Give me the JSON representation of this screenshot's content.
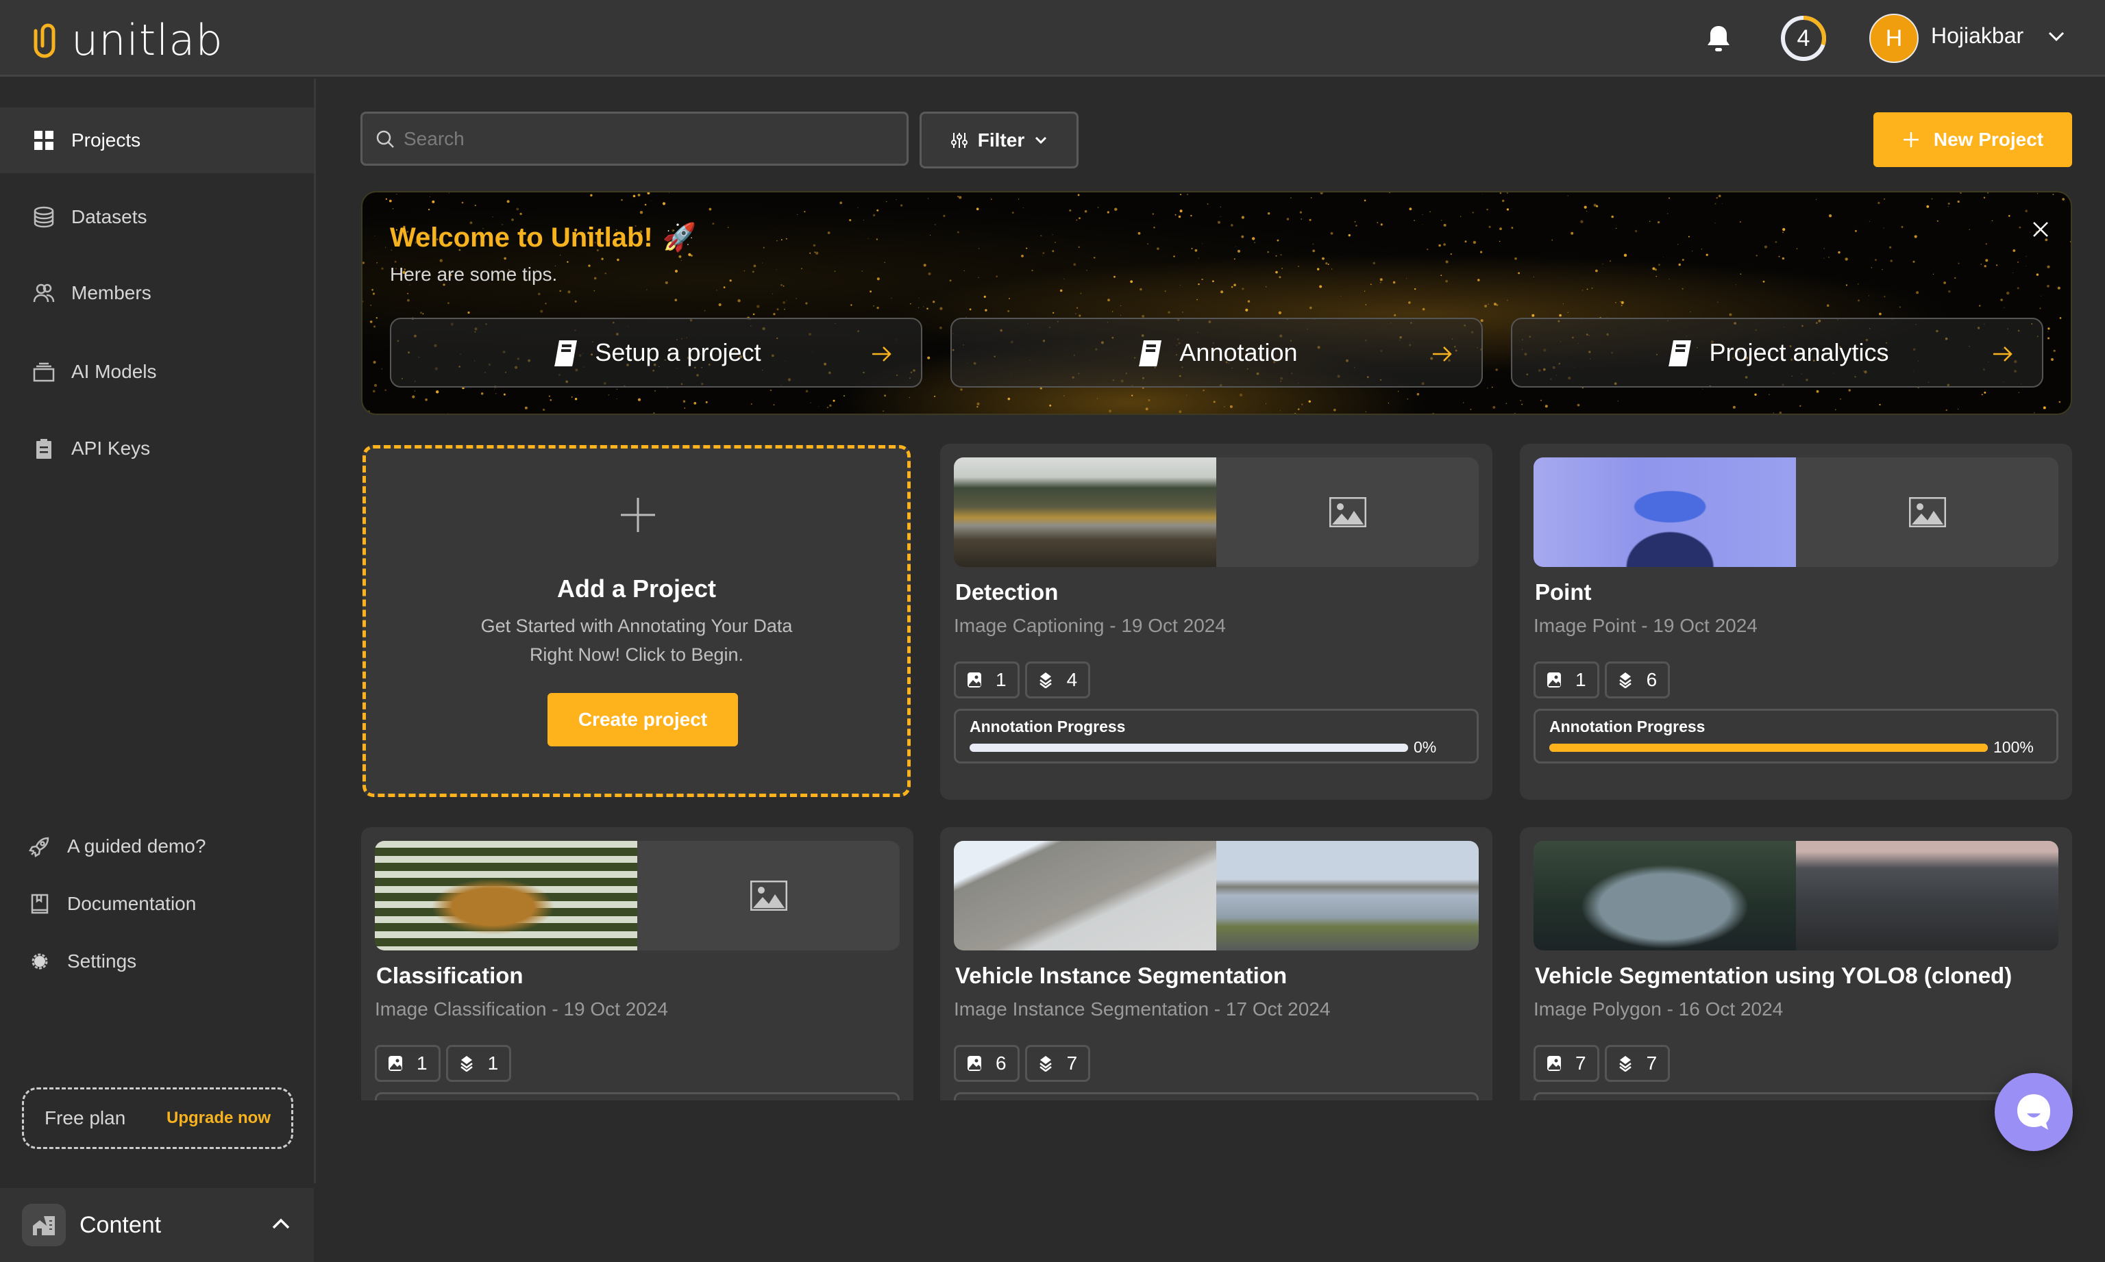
{
  "app": {
    "name": "unitlab"
  },
  "header": {
    "credits": "4",
    "credits_fraction": 0.3,
    "user": {
      "initial": "H",
      "name": "Hojiakbar"
    }
  },
  "sidebar": {
    "items": [
      {
        "label": "Projects",
        "icon": "grid-icon",
        "active": true
      },
      {
        "label": "Datasets",
        "icon": "database-icon"
      },
      {
        "label": "Members",
        "icon": "users-icon"
      },
      {
        "label": "AI Models",
        "icon": "stack-icon"
      },
      {
        "label": "API Keys",
        "icon": "clipboard-icon"
      }
    ],
    "bottom_items": [
      {
        "label": "A guided demo?",
        "icon": "rocket-icon"
      },
      {
        "label": "Documentation",
        "icon": "book-icon"
      },
      {
        "label": "Settings",
        "icon": "gear-icon"
      }
    ],
    "plan": {
      "name": "Free plan",
      "upgrade": "Upgrade now"
    },
    "workspace": {
      "label": "Content"
    }
  },
  "toolbar": {
    "search_placeholder": "Search",
    "search_value": "",
    "filter_label": "Filter",
    "new_project_label": "New Project"
  },
  "banner": {
    "title": "Welcome to Unitlab!",
    "emoji": "🚀",
    "subtitle": "Here are some tips.",
    "tips": [
      {
        "label": "Setup a project"
      },
      {
        "label": "Annotation"
      },
      {
        "label": "Project analytics"
      }
    ]
  },
  "add_card": {
    "title": "Add a Project",
    "description": "Get Started with Annotating Your Data Right Now! Click to Begin.",
    "button": "Create project"
  },
  "colors": {
    "accent": "#feb21c",
    "chat": "#9a8ff5"
  },
  "projects": [
    {
      "title": "Detection",
      "meta": "Image Captioning - 19 Oct 2024",
      "images": "1",
      "layers": "4",
      "progress_label": "Annotation Progress",
      "progress": 0,
      "progress_text": "0%",
      "thumbs": [
        "landscape-jeep",
        "placeholder"
      ]
    },
    {
      "title": "Point",
      "meta": "Image Point - 19 Oct 2024",
      "images": "1",
      "layers": "6",
      "progress_label": "Annotation Progress",
      "progress": 100,
      "progress_text": "100%",
      "thumbs": [
        "portrait-blue",
        "placeholder"
      ]
    },
    {
      "title": "Classification",
      "meta": "Image Classification - 19 Oct 2024",
      "images": "1",
      "layers": "1",
      "thumbs": [
        "tiger",
        "placeholder"
      ]
    },
    {
      "title": "Vehicle Instance Segmentation",
      "meta": "Image Instance Segmentation - 17 Oct 2024",
      "images": "6",
      "layers": "7",
      "thumbs": [
        "cyclist-mountain",
        "cyclist-lake"
      ]
    },
    {
      "title": "Vehicle Segmentation using YOLO8 (cloned)",
      "meta": "Image Polygon - 16 Oct 2024",
      "images": "7",
      "layers": "7",
      "thumbs": [
        "car-grey",
        "cars-mountains"
      ]
    }
  ]
}
